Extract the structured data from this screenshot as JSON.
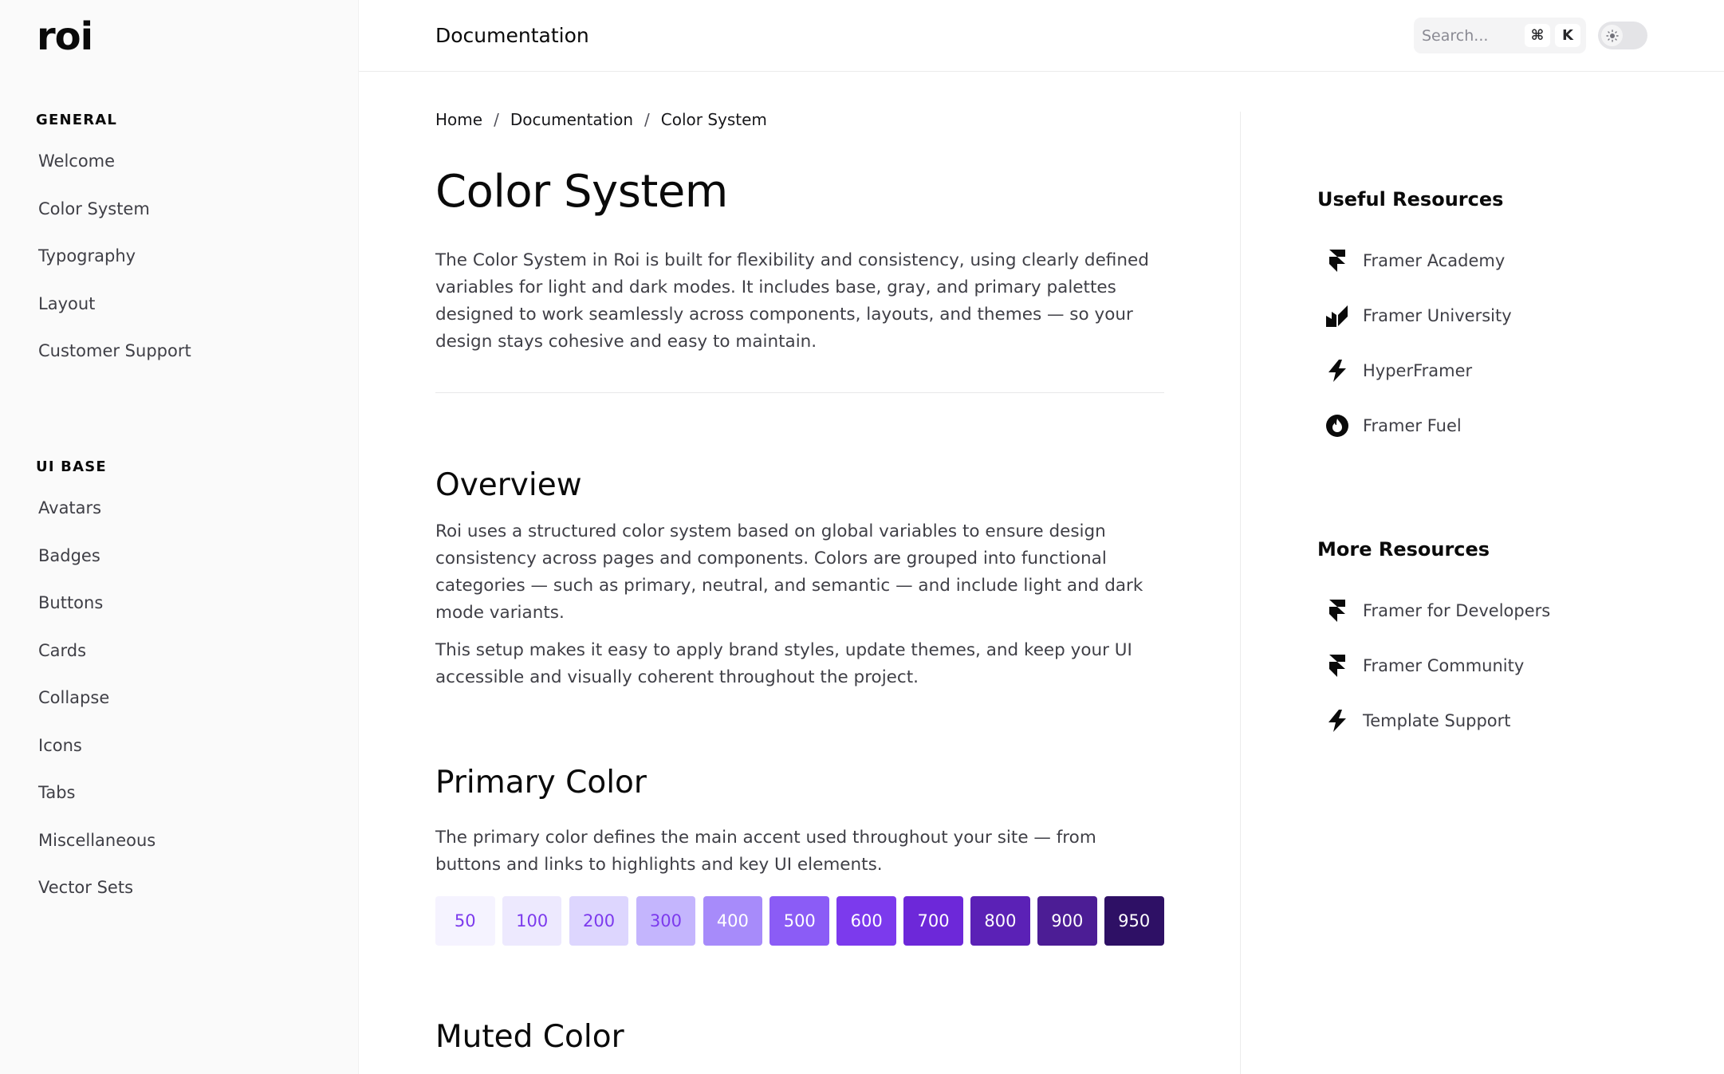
{
  "brand": {
    "logo_text": "roi"
  },
  "header": {
    "title": "Documentation",
    "search": {
      "placeholder": "Search...",
      "shortcut_modifier": "⌘",
      "shortcut_key": "K"
    },
    "theme_toggle": {
      "state": "light"
    }
  },
  "sidebar": {
    "groups": [
      {
        "heading": "GENERAL",
        "items": [
          "Welcome",
          "Color System",
          "Typography",
          "Layout",
          "Customer Support"
        ]
      },
      {
        "heading": "UI BASE",
        "items": [
          "Avatars",
          "Badges",
          "Buttons",
          "Cards",
          "Collapse",
          "Icons",
          "Tabs",
          "Miscellaneous",
          "Vector Sets"
        ]
      }
    ]
  },
  "breadcrumb": {
    "items": [
      "Home",
      "Documentation",
      "Color System"
    ],
    "separator": "/"
  },
  "page": {
    "title": "Color System",
    "intro": "The Color System in Roi is built for flexibility and consistency, using clearly defined variables for light and dark modes. It includes base, gray, and primary palettes designed to work seamlessly across components, layouts, and themes — so your design stays cohesive and easy to maintain.",
    "overview": {
      "heading": "Overview",
      "p1": "Roi uses a structured color system based on global variables to ensure design consistency across pages and components. Colors are grouped into functional categories — such as primary, neutral, and semantic — and include light and dark mode variants.",
      "p2": "This setup makes it easy to apply brand styles, update themes, and keep your UI accessible and visually coherent throughout the project."
    },
    "primary": {
      "heading": "Primary Color",
      "text": "The primary color defines the main accent used throughout your site — from buttons and links to highlights and key UI elements.",
      "swatches": [
        {
          "label": "50",
          "bg": "#f5f3ff",
          "fg": "#7c3aed"
        },
        {
          "label": "100",
          "bg": "#ede9fe",
          "fg": "#7c3aed"
        },
        {
          "label": "200",
          "bg": "#ddd6fe",
          "fg": "#7c3aed"
        },
        {
          "label": "300",
          "bg": "#c4b5fd",
          "fg": "#7c3aed"
        },
        {
          "label": "400",
          "bg": "#a78bfa",
          "fg": "#ffffff"
        },
        {
          "label": "500",
          "bg": "#8b5cf6",
          "fg": "#ffffff"
        },
        {
          "label": "600",
          "bg": "#7c3aed",
          "fg": "#ffffff"
        },
        {
          "label": "700",
          "bg": "#6d28d9",
          "fg": "#ffffff"
        },
        {
          "label": "800",
          "bg": "#5b21b6",
          "fg": "#ffffff"
        },
        {
          "label": "900",
          "bg": "#4c1d95",
          "fg": "#ffffff"
        },
        {
          "label": "950",
          "bg": "#2e1065",
          "fg": "#ffffff"
        }
      ]
    },
    "muted": {
      "heading": "Muted Color"
    }
  },
  "resources": {
    "useful": {
      "heading": "Useful Resources",
      "items": [
        {
          "label": "Framer Academy",
          "icon": "framer-icon"
        },
        {
          "label": "Framer University",
          "icon": "framer-university-icon"
        },
        {
          "label": "HyperFramer",
          "icon": "bolt-icon"
        },
        {
          "label": "Framer Fuel",
          "icon": "flame-icon"
        }
      ]
    },
    "more": {
      "heading": "More Resources",
      "items": [
        {
          "label": "Framer for Developers",
          "icon": "framer-icon"
        },
        {
          "label": "Framer Community",
          "icon": "framer-icon"
        },
        {
          "label": "Template Support",
          "icon": "bolt-icon"
        }
      ]
    }
  }
}
